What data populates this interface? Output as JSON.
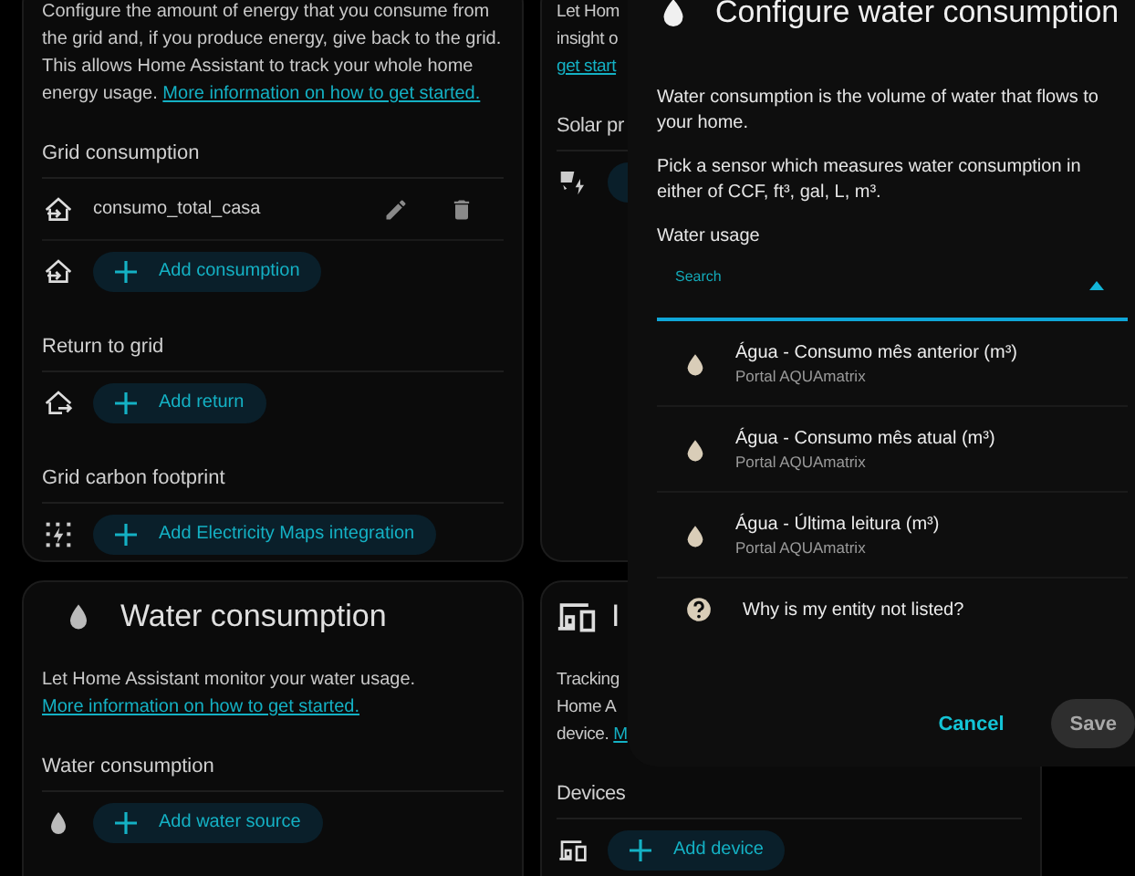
{
  "columns": [
    {
      "cards": [
        {
          "description_lines": [
            {
              "text": "Configure the amount of energy that you consume from the grid and, if you produce energy, give back to the grid. This allows Home Assistant to track your whole home energy usage.",
              "link": "More information on how to get started."
            }
          ],
          "sections": [
            {
              "title": "Grid consumption",
              "kind": "import",
              "rows": [
                {
                  "kind": "entity",
                  "name": "consumo_total_casa"
                },
                {
                  "kind": "add",
                  "label": "Add consumption"
                }
              ]
            },
            {
              "title": "Return to grid",
              "kind": "export",
              "rows": [
                {
                  "kind": "add",
                  "label": "Add return"
                }
              ]
            },
            {
              "title": "Grid carbon footprint",
              "kind": "carbon",
              "rows": [
                {
                  "kind": "add",
                  "label": "Add Electricity Maps integration"
                }
              ]
            }
          ]
        },
        {
          "title": "Water consumption",
          "kind": "water",
          "description_lines": [
            {
              "text": "Let Home Assistant monitor your water usage.",
              "link": "More information on how to get started."
            }
          ],
          "sections": [
            {
              "title": "Water consumption",
              "kind": "water",
              "rows": [
                {
                  "kind": "add",
                  "label": "Add water source"
                }
              ]
            }
          ]
        }
      ]
    },
    {
      "cards": [
        {
          "description_lines": [
            {
              "text": "Let Hom"
            },
            {
              "text": "insight o"
            },
            {
              "link": "get start"
            }
          ],
          "sections": [
            {
              "title": "Solar pr",
              "kind": "solar",
              "rows": [
                {
                  "kind": "add"
                }
              ]
            }
          ]
        },
        {
          "title": "I",
          "kind": "device",
          "description_lines": [
            {
              "text": "Tracking"
            },
            {
              "text": "Home A"
            },
            {
              "text": "device.",
              "link": "M"
            }
          ],
          "sections": [
            {
              "title": "Devices",
              "kind": "device",
              "rows": [
                {
                  "kind": "add",
                  "label": "Add device"
                }
              ]
            }
          ]
        }
      ]
    }
  ],
  "dialog": {
    "title": "Configure water consumption",
    "paragraphs": [
      "Water consumption is the volume of water that flows to your home.",
      "Pick a sensor which measures water consumption in either of CCF, ft³, gal, L, m³."
    ],
    "field_label": "Water usage",
    "search": {
      "label": "Search",
      "focused": true
    },
    "options": [
      {
        "kind": "entity",
        "name": "Água - Consumo mês anterior (m³)",
        "source": "Portal AQUAmatrix"
      },
      {
        "kind": "entity",
        "name": "Água - Consumo mês atual (m³)",
        "source": "Portal AQUAmatrix"
      },
      {
        "kind": "entity",
        "name": "Água - Última leitura (m³)",
        "source": "Portal AQUAmatrix"
      },
      {
        "kind": "help",
        "name": "Why is my entity not listed?"
      }
    ],
    "cancel": {
      "label": "Cancel"
    },
    "save": {
      "label": "Save",
      "disabled": true
    }
  }
}
